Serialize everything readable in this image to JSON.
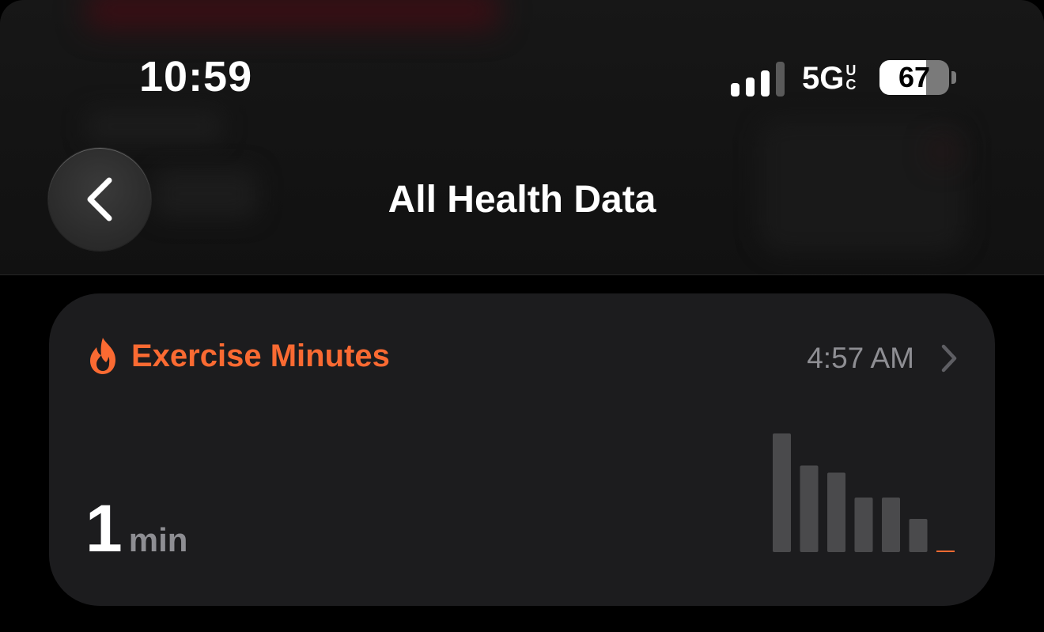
{
  "status_bar": {
    "time": "10:59",
    "network": "5G",
    "network_sub": [
      "U",
      "C"
    ],
    "battery_percent": "67",
    "battery_level": 0.67,
    "signal_bars": 4,
    "signal_bars_active": 3
  },
  "nav": {
    "title": "All Health Data",
    "back_icon": "chevron-left-icon"
  },
  "card": {
    "icon": "flame-icon",
    "title": "Exercise Minutes",
    "time": "4:57 AM",
    "value": "1",
    "unit": "min",
    "accent_color": "#fa6a32"
  },
  "chart_data": {
    "type": "bar",
    "values": [
      100,
      73,
      67,
      46,
      46,
      28,
      1
    ],
    "bar_color": "#4a4a4c",
    "highlight_color": "#fa6a32",
    "highlight_index": 6
  }
}
